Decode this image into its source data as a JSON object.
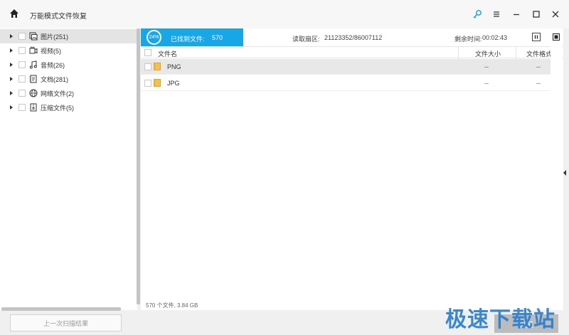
{
  "app": {
    "title": "万能模式文件恢复"
  },
  "window_controls": {
    "icons": [
      "key-icon",
      "menu-icon",
      "minimize-icon",
      "maximize-icon",
      "close-icon"
    ]
  },
  "tree": {
    "items": [
      {
        "label": "图片(251)",
        "icon": "image-icon"
      },
      {
        "label": "视频(5)",
        "icon": "video-icon"
      },
      {
        "label": "音频(26)",
        "icon": "music-icon"
      },
      {
        "label": "文档(281)",
        "icon": "document-icon"
      },
      {
        "label": "网络文件(2)",
        "icon": "globe-icon"
      },
      {
        "label": "压缩文件(5)",
        "icon": "archive-icon"
      }
    ],
    "prev_scan_label": "上一次扫描结果"
  },
  "scan": {
    "progress_percent": 24,
    "progress_label": "24%",
    "found_label": "已找到文件:",
    "found_count": "570",
    "read_label": "读取扇区:",
    "read_value": "21123352/86007112",
    "remain_label": "剩余时间:",
    "remain_value": "00:02:43"
  },
  "table": {
    "columns": {
      "name": "文件名",
      "size": "文件大小",
      "type": "文件格式"
    },
    "rows": [
      {
        "name": "PNG",
        "size": "--",
        "type": "--"
      },
      {
        "name": "JPG",
        "size": "--",
        "type": "--"
      }
    ]
  },
  "footer": {
    "summary": "570 个文件, 3.84 GB",
    "recover_label": "恢复"
  },
  "watermark": {
    "text": "极速下载站"
  },
  "colors": {
    "accent": "#17a6e6",
    "selected_row": "#e8e8e8"
  }
}
